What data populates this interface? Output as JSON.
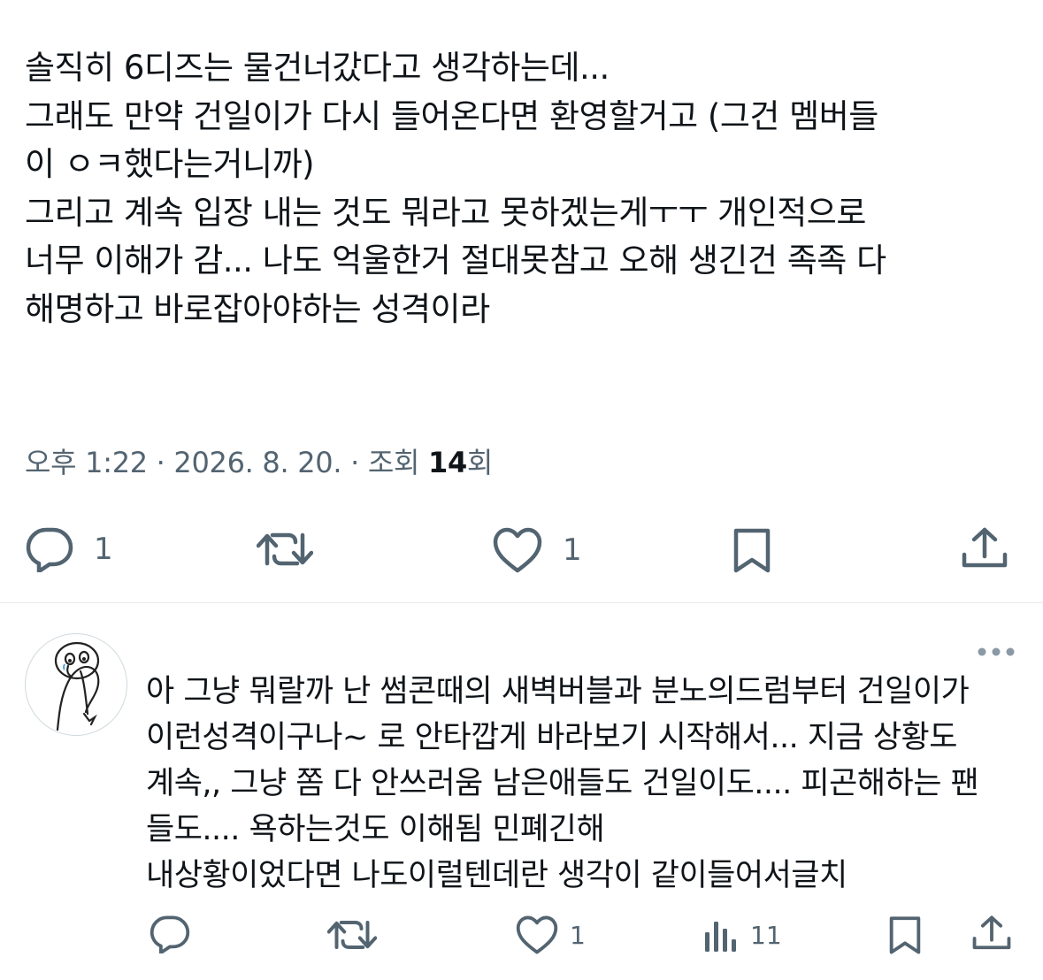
{
  "tweet": {
    "lines": [
      "솔직히 6디즈는 물건너갔다고 생각하는데...",
      "그래도 만약 건일이가 다시 들어온다면 환영할거고 (그건 멤버들",
      "이 ㅇㅋ했다는거니까)",
      "그리고 계속 입장 내는 것도 뭐라고 못하겠는게ㅜㅜ 개인적으로",
      "너무 이해가 감... 나도 억울한거 절대못참고 오해 생긴건 족족 다",
      "해명하고 바로잡아야하는 성격이라"
    ],
    "meta_prefix": "오후 1:22 · 2026. 8. 20. · 조회 ",
    "views": "14",
    "views_suffix": "회",
    "reply_count": "1",
    "like_count": "1"
  },
  "reply": {
    "lines": [
      "아 그냥 뭐랄까 난 썸콘때의 새벽버블과 분노의드럼부터 건일이가",
      "이런성격이구나~ 로 안타깝게 바라보기 시작해서... 지금 상황도",
      "계속,, 그냥 쫌 다 안쓰러움 남은애들도 건일이도.... 피곤해하는 팬",
      "들도.... 욕하는것도 이해됨 민폐긴해",
      "내상황이었다면 나도이럴텐데란 생각이 같이들어서글치"
    ],
    "like_count": "1",
    "view_count": "11"
  },
  "colors": {
    "text": "#0f1419",
    "secondary": "#536471",
    "divider": "#e6e9ec",
    "more_dots": "#8b98a5"
  },
  "icons": [
    "reply-icon",
    "retweet-icon",
    "like-icon",
    "bookmark-icon",
    "share-icon",
    "views-icon",
    "more-icon"
  ]
}
